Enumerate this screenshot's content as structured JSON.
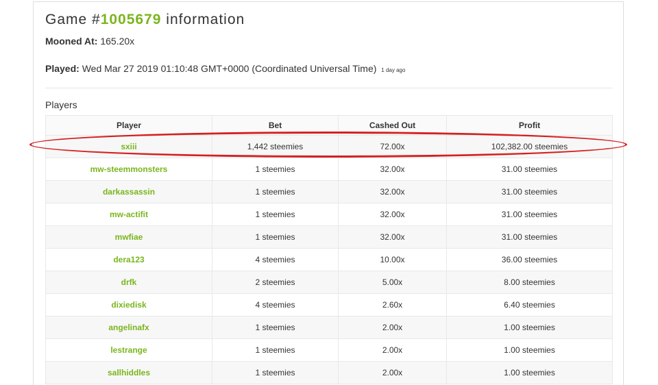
{
  "game": {
    "title_prefix": "Game #",
    "id": "1005679",
    "title_suffix": " information",
    "mooned_label": "Mooned At:",
    "mooned_value": "165.20x",
    "played_label": "Played:",
    "played_value": "Wed Mar 27 2019 01:10:48 GMT+0000 (Coordinated Universal Time)",
    "played_ago": "1 day ago"
  },
  "players_section": {
    "heading": "Players",
    "columns": [
      "Player",
      "Bet",
      "Cashed Out",
      "Profit"
    ],
    "rows": [
      {
        "player": "sxiii",
        "bet": "1,442 steemies",
        "cashed_out": "72.00x",
        "profit": "102,382.00 steemies"
      },
      {
        "player": "mw-steemmonsters",
        "bet": "1 steemies",
        "cashed_out": "32.00x",
        "profit": "31.00 steemies"
      },
      {
        "player": "darkassassin",
        "bet": "1 steemies",
        "cashed_out": "32.00x",
        "profit": "31.00 steemies"
      },
      {
        "player": "mw-actifit",
        "bet": "1 steemies",
        "cashed_out": "32.00x",
        "profit": "31.00 steemies"
      },
      {
        "player": "mwfiae",
        "bet": "1 steemies",
        "cashed_out": "32.00x",
        "profit": "31.00 steemies"
      },
      {
        "player": "dera123",
        "bet": "4 steemies",
        "cashed_out": "10.00x",
        "profit": "36.00 steemies"
      },
      {
        "player": "drfk",
        "bet": "2 steemies",
        "cashed_out": "5.00x",
        "profit": "8.00 steemies"
      },
      {
        "player": "dixiedisk",
        "bet": "4 steemies",
        "cashed_out": "2.60x",
        "profit": "6.40 steemies"
      },
      {
        "player": "angelinafx",
        "bet": "1 steemies",
        "cashed_out": "2.00x",
        "profit": "1.00 steemies"
      },
      {
        "player": "lestrange",
        "bet": "1 steemies",
        "cashed_out": "2.00x",
        "profit": "1.00 steemies"
      },
      {
        "player": "sallhiddles",
        "bet": "1 steemies",
        "cashed_out": "2.00x",
        "profit": "1.00 steemies"
      }
    ]
  },
  "colors": {
    "accent_green": "#7ab51d",
    "highlight_red": "#d61f1f"
  }
}
